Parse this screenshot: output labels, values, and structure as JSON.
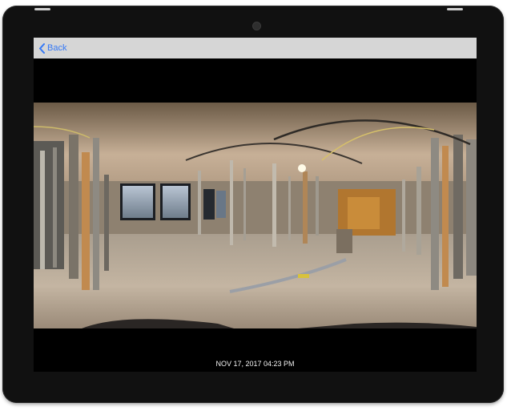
{
  "nav": {
    "back_label": "Back"
  },
  "photo": {
    "timestamp": "NOV 17, 2017 04:23 PM"
  },
  "colors": {
    "accent": "#3478f6",
    "navbar": "#d6d6d6",
    "device": "#111111"
  },
  "icons": {
    "back": "chevron-left-icon"
  }
}
